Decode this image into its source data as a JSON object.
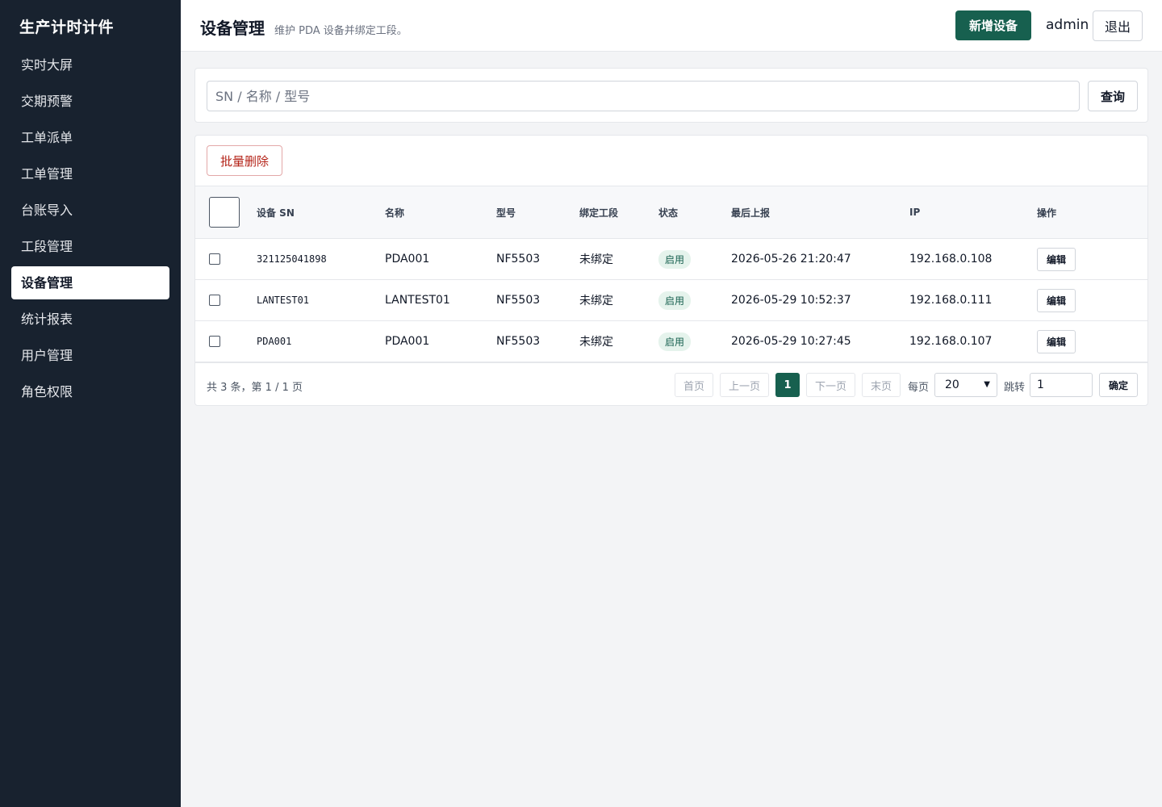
{
  "app": {
    "brand": "生产计时计件"
  },
  "sidebar": {
    "items": [
      {
        "label": "实时大屏",
        "active": false
      },
      {
        "label": "交期预警",
        "active": false
      },
      {
        "label": "工单派单",
        "active": false
      },
      {
        "label": "工单管理",
        "active": false
      },
      {
        "label": "台账导入",
        "active": false
      },
      {
        "label": "工段管理",
        "active": false
      },
      {
        "label": "设备管理",
        "active": true
      },
      {
        "label": "统计报表",
        "active": false
      },
      {
        "label": "用户管理",
        "active": false
      },
      {
        "label": "角色权限",
        "active": false
      }
    ]
  },
  "header": {
    "title": "设备管理",
    "subtitle": "维护 PDA 设备并绑定工段。",
    "add_button": "新增设备",
    "user": "admin",
    "logout_button": "退出"
  },
  "search": {
    "placeholder": "SN / 名称 / 型号",
    "value": "",
    "query_button": "查询"
  },
  "toolbar": {
    "batch_delete": "批量删除"
  },
  "table": {
    "columns": [
      "设备 SN",
      "名称",
      "型号",
      "绑定工段",
      "状态",
      "最后上报",
      "IP",
      "操作"
    ],
    "rows": [
      {
        "sn": "321125041898",
        "name": "PDA001",
        "model": "NF5503",
        "binding": "未绑定",
        "status": "启用",
        "last_report": "2026-05-26 21:20:47",
        "ip": "192.168.0.108",
        "action": "编辑"
      },
      {
        "sn": "LANTEST01",
        "name": "LANTEST01",
        "model": "NF5503",
        "binding": "未绑定",
        "status": "启用",
        "last_report": "2026-05-29 10:52:37",
        "ip": "192.168.0.111",
        "action": "编辑"
      },
      {
        "sn": "PDA001",
        "name": "PDA001",
        "model": "NF5503",
        "binding": "未绑定",
        "status": "启用",
        "last_report": "2026-05-29 10:27:45",
        "ip": "192.168.0.107",
        "action": "编辑"
      }
    ]
  },
  "pagination": {
    "summary": "共 3 条，第 1 / 1 页",
    "first": "首页",
    "prev": "上一页",
    "current": "1",
    "next": "下一页",
    "last": "末页",
    "per_page_label": "每页",
    "per_page_value": "20",
    "jump_label": "跳转",
    "jump_value": "1",
    "confirm": "确定"
  },
  "colors": {
    "sidebar_bg": "#18222f",
    "accent": "#17604f",
    "danger": "#b42318",
    "badge_bg": "#e5f3ec"
  }
}
